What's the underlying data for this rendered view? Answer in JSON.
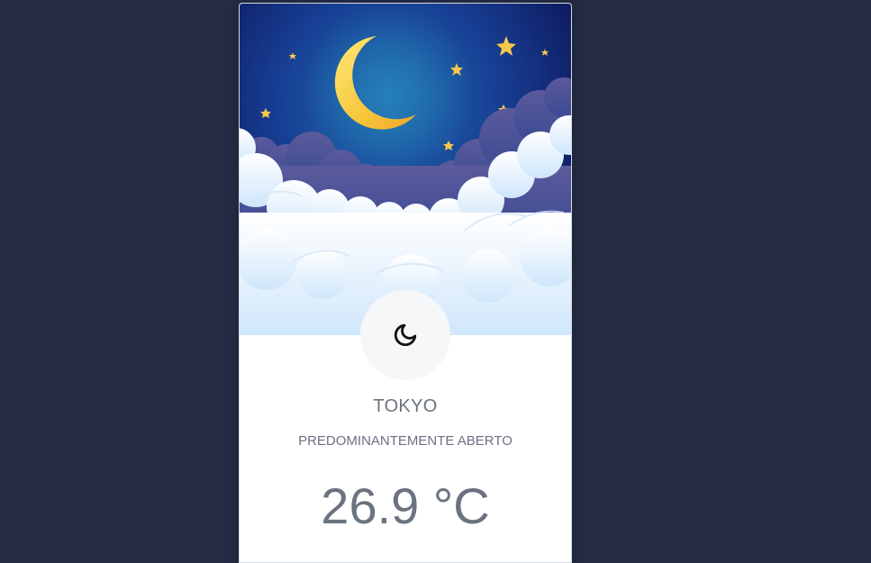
{
  "weather": {
    "city": "TOKYO",
    "condition": "PREDOMINANTEMENTE ABERTO",
    "temperature": "26.9 °C",
    "icon": "moon-icon",
    "hero_image": "night-sky-moon-clouds-illustration"
  },
  "colors": {
    "page_background": "#232c42",
    "sky_center": "#1e5aa6",
    "sky_edge": "#0d0f4a",
    "moon": "#f5c63b",
    "text": "#6b7280"
  }
}
